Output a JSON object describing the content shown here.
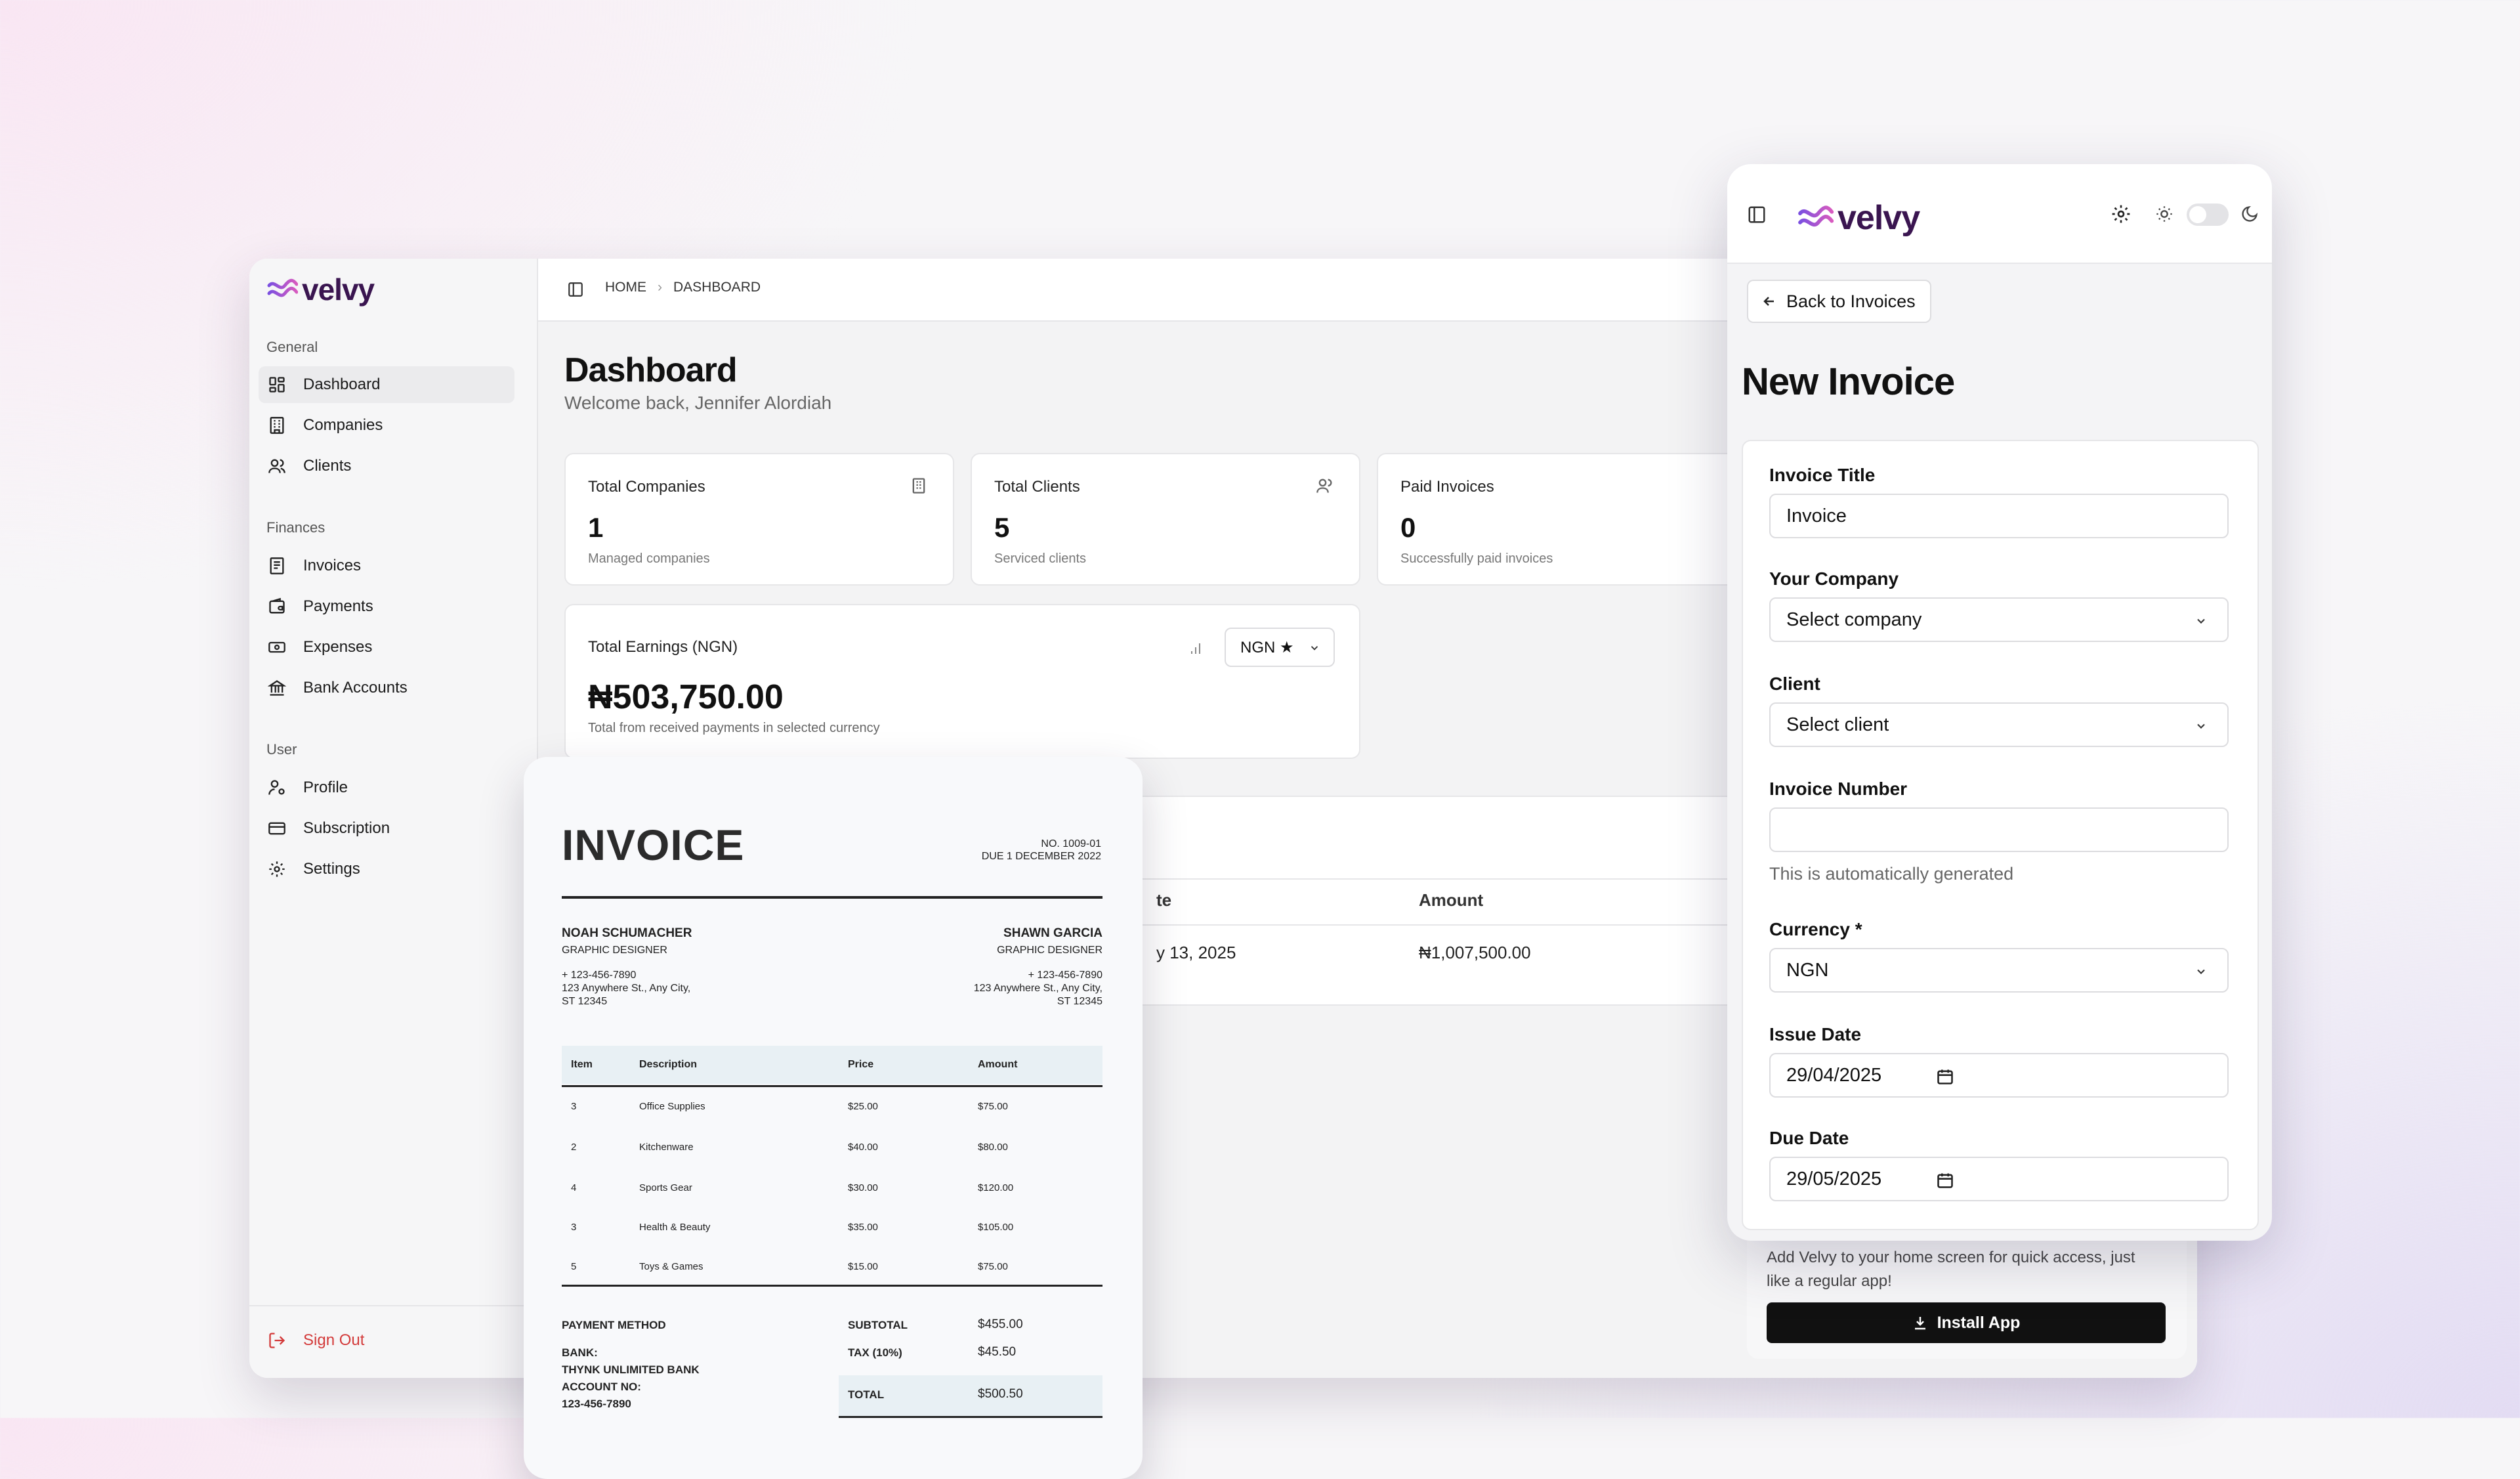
{
  "brand": {
    "name": "velvy"
  },
  "sidebar": {
    "sections": [
      {
        "title": "General",
        "items": [
          {
            "label": "Dashboard",
            "icon": "grid-icon",
            "active": true
          },
          {
            "label": "Companies",
            "icon": "building-icon"
          },
          {
            "label": "Clients",
            "icon": "users-icon"
          }
        ]
      },
      {
        "title": "Finances",
        "items": [
          {
            "label": "Invoices",
            "icon": "receipt-icon"
          },
          {
            "label": "Payments",
            "icon": "wallet-icon"
          },
          {
            "label": "Expenses",
            "icon": "banknote-icon"
          },
          {
            "label": "Bank Accounts",
            "icon": "bank-icon"
          }
        ]
      },
      {
        "title": "User",
        "items": [
          {
            "label": "Profile",
            "icon": "user-cog-icon"
          },
          {
            "label": "Subscription",
            "icon": "credit-card-icon"
          },
          {
            "label": "Settings",
            "icon": "gear-icon"
          }
        ]
      }
    ],
    "signout": "Sign Out"
  },
  "breadcrumb": {
    "home": "HOME",
    "current": "DASHBOARD"
  },
  "dashboard": {
    "title": "Dashboard",
    "welcome": "Welcome back, Jennifer Alordiah",
    "cards": [
      {
        "title": "Total Companies",
        "value": "1",
        "sub": "Managed companies"
      },
      {
        "title": "Total Clients",
        "value": "5",
        "sub": "Serviced clients"
      },
      {
        "title": "Paid Invoices",
        "value": "0",
        "sub": "Successfully paid invoices"
      }
    ],
    "earnings": {
      "title": "Total Earnings (NGN)",
      "currency_select": "NGN ★",
      "value": "₦503,750.00",
      "sub": "Total from received payments in selected currency"
    },
    "table": {
      "header_date_fragment": "te",
      "header_amount": "Amount",
      "row_date_fragment": "y 13, 2025",
      "row_amount": "₦1,007,500.00"
    }
  },
  "invoice_doc": {
    "title": "INVOICE",
    "number": "NO. 1009-01",
    "due": "DUE 1 DECEMBER 2022",
    "from": {
      "name": "NOAH SCHUMACHER",
      "role": "GRAPHIC DESIGNER",
      "phone": "+ 123-456-7890",
      "addr1": "123 Anywhere St., Any City,",
      "addr2": "ST 12345"
    },
    "to": {
      "name": "SHAWN GARCIA",
      "role": "GRAPHIC DESIGNER",
      "phone": "+ 123-456-7890",
      "addr1": "123 Anywhere St., Any City,",
      "addr2": "ST 12345"
    },
    "columns": [
      "Item",
      "Description",
      "Price",
      "Amount"
    ],
    "rows": [
      [
        "3",
        "Office Supplies",
        "$25.00",
        "$75.00"
      ],
      [
        "2",
        "Kitchenware",
        "$40.00",
        "$80.00"
      ],
      [
        "4",
        "Sports Gear",
        "$30.00",
        "$120.00"
      ],
      [
        "3",
        "Health & Beauty",
        "$35.00",
        "$105.00"
      ],
      [
        "5",
        "Toys & Games",
        "$15.00",
        "$75.00"
      ]
    ],
    "payment_method": "PAYMENT METHOD",
    "bank_label": "BANK:",
    "bank_name": "THYNK UNLIMITED BANK",
    "account_label": "ACCOUNT NO:",
    "account_no": "123-456-7890",
    "subtotal_label": "SUBTOTAL",
    "subtotal": "$455.00",
    "tax_label": "TAX (10%)",
    "tax": "$45.50",
    "total_label": "TOTAL",
    "total": "$500.50"
  },
  "panel": {
    "back": "Back to Invoices",
    "title": "New Invoice",
    "fields": {
      "invoice_title_label": "Invoice Title",
      "invoice_title_value": "Invoice",
      "company_label": "Your Company",
      "company_value": "Select company",
      "client_label": "Client",
      "client_value": "Select client",
      "number_label": "Invoice Number",
      "number_value": "",
      "number_help": "This is automatically generated",
      "currency_label": "Currency *",
      "currency_value": "NGN",
      "issue_label": "Issue Date",
      "issue_value": "29/04/2025",
      "due_label": "Due Date",
      "due_value": "29/05/2025"
    },
    "install": {
      "text1": "Add Velvy to your home screen for quick access, just",
      "text2": "like a regular app!",
      "button": "Install App"
    }
  },
  "colors": {
    "brand_dark": "#3a1550",
    "brand_wave_a": "#7b4fe0",
    "brand_wave_b": "#d85bbf",
    "danger": "#d33a3a"
  }
}
